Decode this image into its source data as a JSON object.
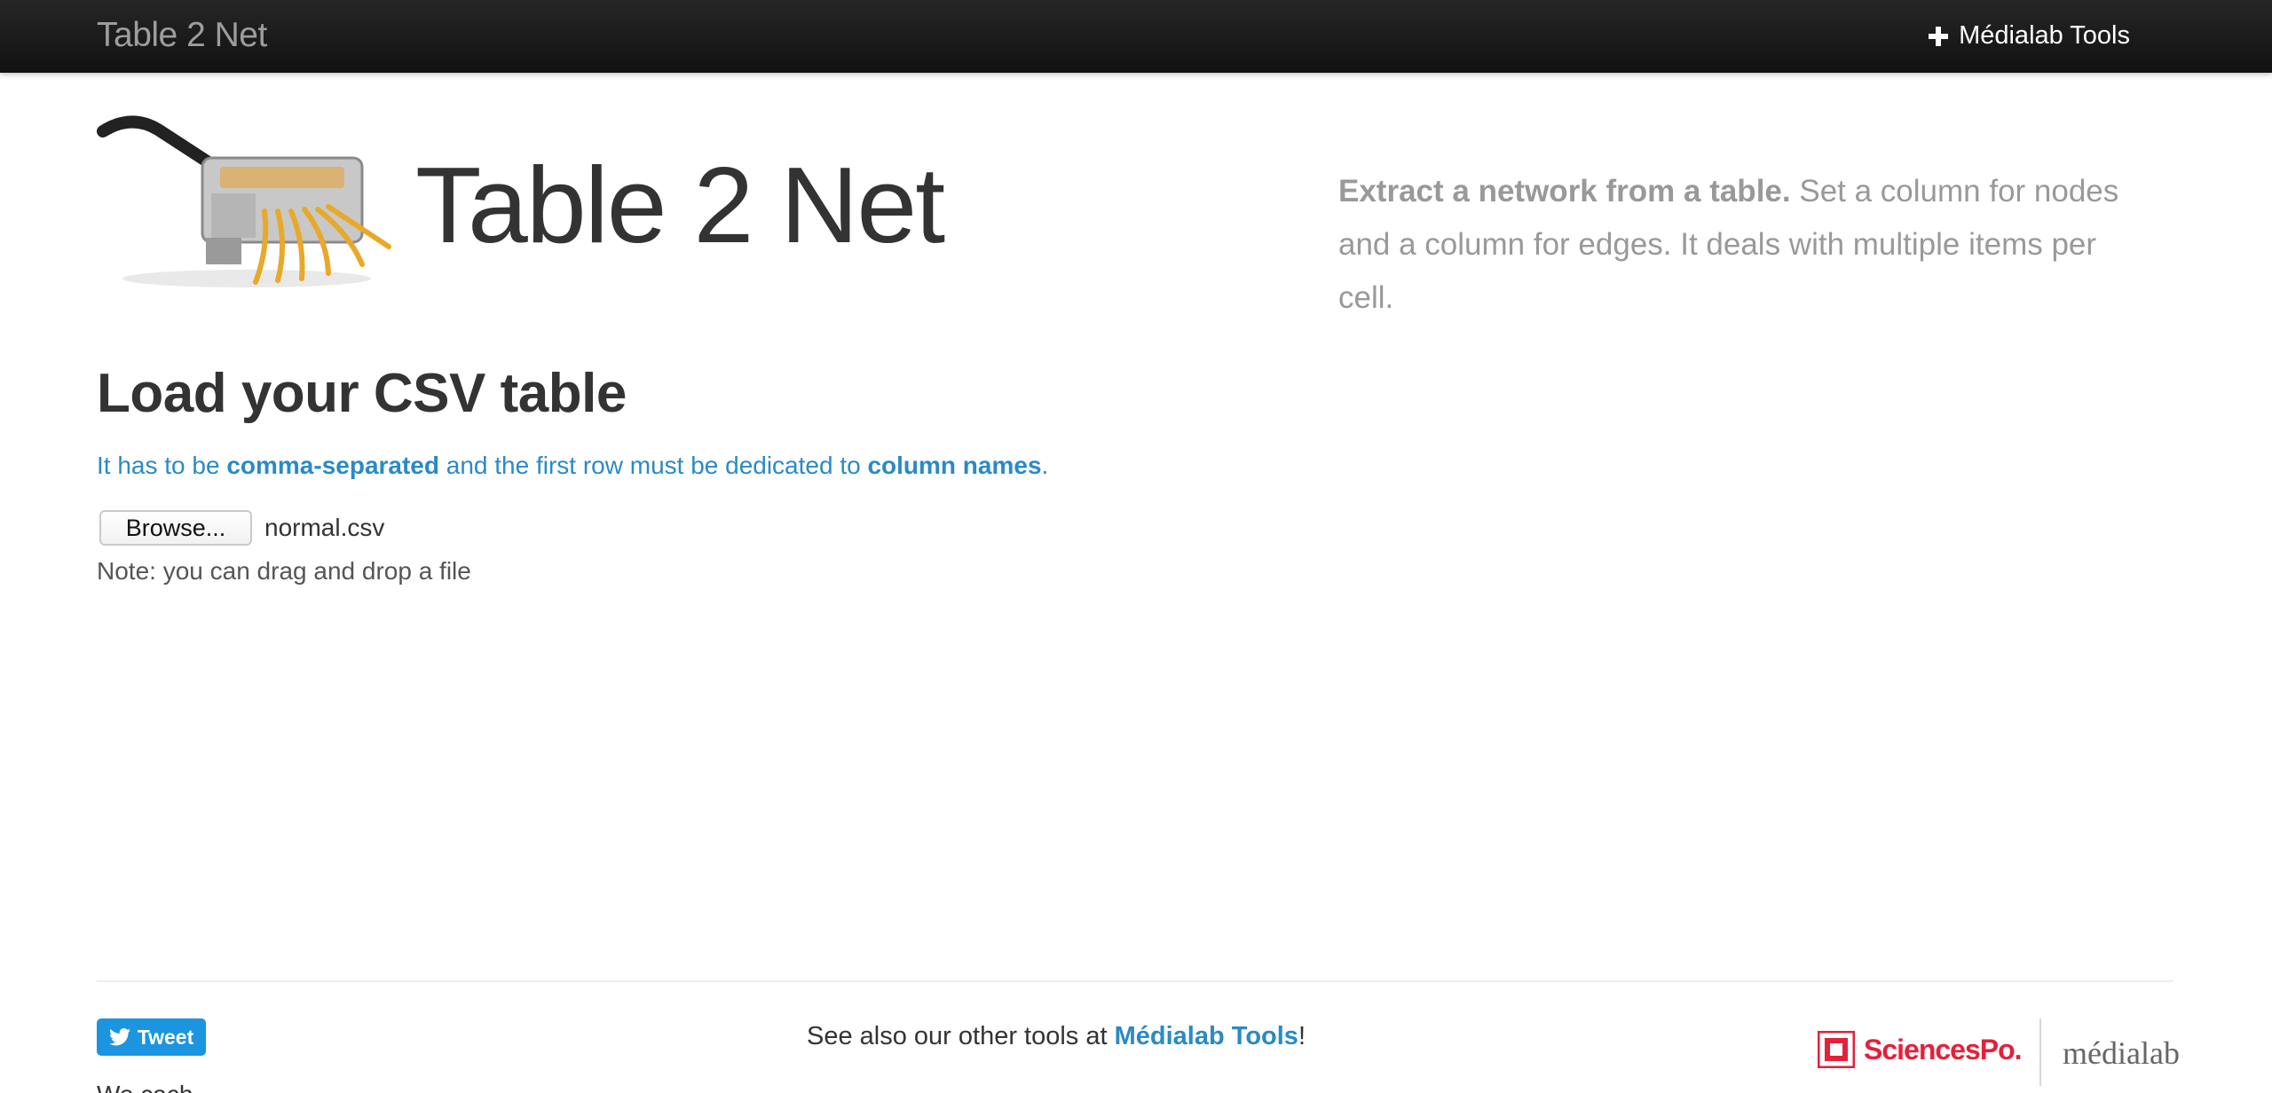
{
  "navbar": {
    "brand": "Table 2 Net",
    "tools_label": "Médialab Tools",
    "tools_icon": "plus-icon"
  },
  "header": {
    "title": "Table 2 Net",
    "image_icon": "pasta-machine-illustration",
    "lead_strong": "Extract a network from a table.",
    "lead_rest": "Set a column for nodes and a column for edges. It deals with multiple items per cell."
  },
  "main": {
    "section_title": "Load your CSV table",
    "info": {
      "part1": "It has to be ",
      "strong1": "comma-separated",
      "part2": " and the first row must be dedicated to ",
      "strong2": "column names",
      "part3": "."
    },
    "browse_label": "Browse...",
    "file_name": "normal.csv",
    "note": "Note: you can drag and drop a file"
  },
  "footer": {
    "tweet_label": "Tweet",
    "see_also_prefix": "See also our other tools at ",
    "see_also_link": "Médialab Tools",
    "see_also_suffix": "!",
    "partial_text": "We cach",
    "sciencespo_label": "SciencesPo.",
    "medialab_label": "médialab"
  },
  "colors": {
    "navbar_bg": "#1b1b1b",
    "link_blue": "#2a8ac6",
    "tweet_blue": "#1b95e0",
    "sciencespo_red": "#e3213b"
  }
}
